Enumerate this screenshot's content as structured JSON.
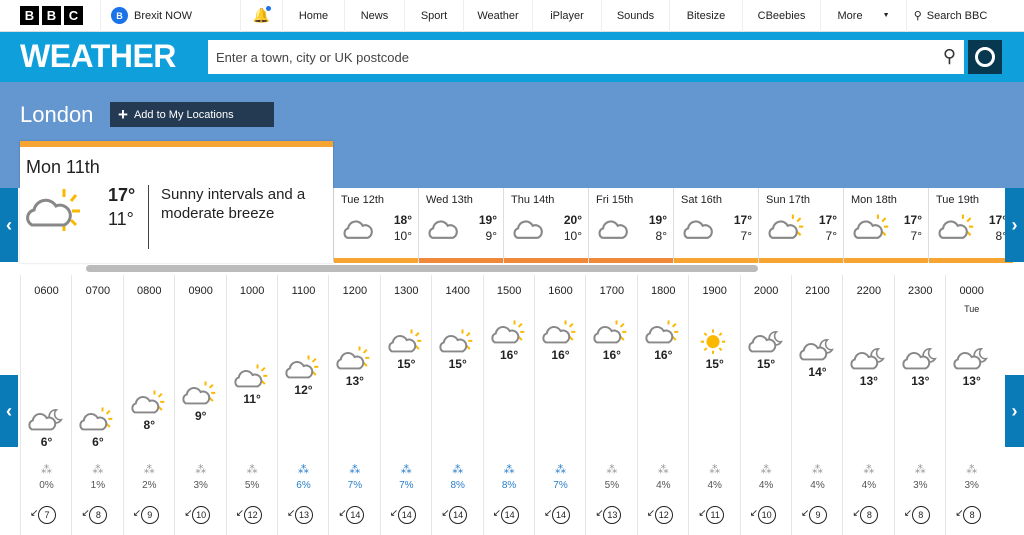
{
  "topnav": {
    "logo": [
      "B",
      "B",
      "C"
    ],
    "promo": "Brexit NOW",
    "items": [
      "Home",
      "News",
      "Sport",
      "Weather",
      "iPlayer",
      "Sounds",
      "Bitesize",
      "CBeebies",
      "More"
    ],
    "search": "Search BBC"
  },
  "weather": {
    "title": "WEATHER",
    "search_placeholder": "Enter a town, city or UK postcode"
  },
  "location": {
    "city": "London",
    "add_label": "Add to My Locations"
  },
  "selected_day": {
    "label": "Mon 11th",
    "high": "17°",
    "low": "11°",
    "description": "Sunny intervals and a moderate breeze",
    "icon": "sun-cloud"
  },
  "days": [
    {
      "label": "Tue 12th",
      "high": "18°",
      "low": "10°",
      "icon": "cloud",
      "bar": "#f7a532"
    },
    {
      "label": "Wed 13th",
      "high": "19°",
      "low": "9°",
      "icon": "cloud",
      "bar": "#f0883a"
    },
    {
      "label": "Thu 14th",
      "high": "20°",
      "low": "10°",
      "icon": "cloud",
      "bar": "#f0883a"
    },
    {
      "label": "Fri 15th",
      "high": "19°",
      "low": "8°",
      "icon": "cloud",
      "bar": "#f0883a"
    },
    {
      "label": "Sat 16th",
      "high": "17°",
      "low": "7°",
      "icon": "cloud",
      "bar": "#f7a532"
    },
    {
      "label": "Sun 17th",
      "high": "17°",
      "low": "7°",
      "icon": "sun-cloud",
      "bar": "#f7a532"
    },
    {
      "label": "Mon 18th",
      "high": "17°",
      "low": "7°",
      "icon": "sun-cloud",
      "bar": "#f7a532"
    },
    {
      "label": "Tue 19th",
      "high": "17°",
      "low": "8°",
      "icon": "sun-cloud",
      "bar": "#f7a532"
    }
  ],
  "hours": [
    {
      "time": "0600",
      "temp": 6,
      "icon": "cloud-moon",
      "rain": "0%",
      "wind": "7"
    },
    {
      "time": "0700",
      "temp": 6,
      "icon": "sun-cloud",
      "rain": "1%",
      "wind": "8"
    },
    {
      "time": "0800",
      "temp": 8,
      "icon": "sun-cloud",
      "rain": "2%",
      "wind": "9"
    },
    {
      "time": "0900",
      "temp": 9,
      "icon": "sun-cloud",
      "rain": "3%",
      "wind": "10"
    },
    {
      "time": "1000",
      "temp": 11,
      "icon": "sun-cloud",
      "rain": "5%",
      "wind": "12"
    },
    {
      "time": "1100",
      "temp": 12,
      "icon": "sun-cloud",
      "rain": "6%",
      "wind": "13"
    },
    {
      "time": "1200",
      "temp": 13,
      "icon": "sun-cloud",
      "rain": "7%",
      "wind": "14"
    },
    {
      "time": "1300",
      "temp": 15,
      "icon": "sun-cloud",
      "rain": "7%",
      "wind": "14"
    },
    {
      "time": "1400",
      "temp": 15,
      "icon": "sun-cloud",
      "rain": "8%",
      "wind": "14"
    },
    {
      "time": "1500",
      "temp": 16,
      "icon": "sun-cloud",
      "rain": "8%",
      "wind": "14"
    },
    {
      "time": "1600",
      "temp": 16,
      "icon": "sun-cloud",
      "rain": "7%",
      "wind": "14"
    },
    {
      "time": "1700",
      "temp": 16,
      "icon": "sun-cloud",
      "rain": "5%",
      "wind": "13"
    },
    {
      "time": "1800",
      "temp": 16,
      "icon": "sun-cloud",
      "rain": "4%",
      "wind": "12"
    },
    {
      "time": "1900",
      "temp": 15,
      "icon": "sun",
      "rain": "4%",
      "wind": "11"
    },
    {
      "time": "2000",
      "temp": 15,
      "icon": "cloud-moon",
      "rain": "4%",
      "wind": "10"
    },
    {
      "time": "2100",
      "temp": 14,
      "icon": "moon-cloud",
      "rain": "4%",
      "wind": "9"
    },
    {
      "time": "2200",
      "temp": 13,
      "icon": "cloud-moon",
      "rain": "4%",
      "wind": "8"
    },
    {
      "time": "2300",
      "temp": 13,
      "icon": "cloud-moon",
      "rain": "3%",
      "wind": "8"
    },
    {
      "time": "0000",
      "sub": "Tue",
      "temp": 13,
      "icon": "cloud-moon",
      "rain": "3%",
      "wind": "8"
    }
  ],
  "colors": {
    "brand": "#0f9fdb",
    "sky": "#6496d0",
    "rain_high": "#2a7fc9",
    "sun": "#fbb800"
  }
}
